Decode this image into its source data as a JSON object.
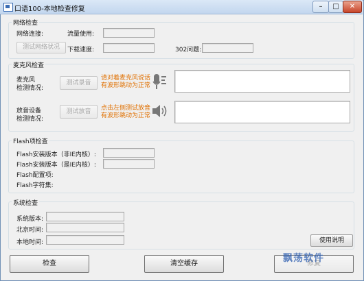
{
  "window": {
    "title": "口语100-本地检查修复"
  },
  "network": {
    "title": "网络检查",
    "conn_label": "网络连接:",
    "traffic_label": "流量使用:",
    "test_button": "测试网络状况",
    "speed_label": "下载速度:",
    "issue302_label": "302问题:"
  },
  "mic": {
    "title": "麦克风检查",
    "status_label_line1": "麦克风",
    "status_label_line2": "检测情况:",
    "test_button": "测试录音",
    "hint_line1": "请对着麦克风说话",
    "hint_line2": "有波形跳动为正常",
    "playback_label_line1": "放音设备",
    "playback_label_line2": "检测情况:",
    "play_button": "测试放音",
    "play_hint_line1": "点击左侧测试放音",
    "play_hint_line2": "有波形跳动为正常"
  },
  "flash": {
    "title": "Flash项检查",
    "non_ie_label": "Flash安装版本（非IE内核）:",
    "ie_label": "Flash安装版本（是IE内核）:",
    "config_label": "Flash配置项:",
    "charset_label": "Flash字符集:"
  },
  "system": {
    "title": "系统检查",
    "version_label": "系统版本:",
    "beijing_time_label": "北京时间:",
    "local_time_label": "本地时间:",
    "help_button": "使用说明"
  },
  "bottom": {
    "check_button": "检查",
    "clear_cache_button": "清空缓存",
    "repair_button": "修复"
  },
  "watermark": {
    "text": "飘荡软件"
  },
  "icons": {
    "mic": "microphone-icon",
    "speaker": "speaker-icon"
  }
}
